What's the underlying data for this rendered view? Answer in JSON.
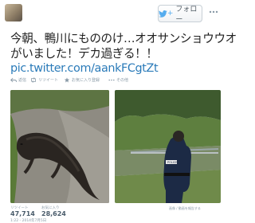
{
  "header": {
    "follow_label": "フォロー"
  },
  "tweet": {
    "line1": "今朝、鴨川にもののけ…オオサンショウウオ",
    "line2": "がいました！デカ過ぎる！！",
    "link": "pic.twitter.com/aankFCgtZt"
  },
  "actions": {
    "reply": "返信",
    "retweet": "リツイート",
    "favorite": "お気に入り登録",
    "more": "その他"
  },
  "media": {
    "left_alt": "オオサンショウウオ",
    "right_alt": "POLICE",
    "credit": "画像 / 動画を報告する"
  },
  "stats": {
    "retweets_label": "リツイート",
    "retweets_value": "47,714",
    "favorites_label": "お気に入り",
    "favorites_value": "28,624"
  },
  "timestamp": "1:22 - 2014年7月5日",
  "colors": {
    "link": "#2b7bb9",
    "muted": "#8899a6",
    "brand": "#55acee"
  }
}
